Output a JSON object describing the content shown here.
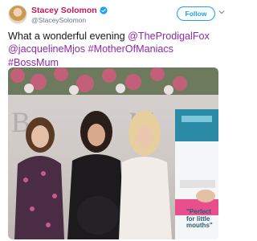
{
  "tweet": {
    "author": {
      "display_name": "Stacey Solomon",
      "handle": "@StaceySolomon",
      "verified": true,
      "name_color": "#c2185b"
    },
    "follow_label": "Follow",
    "text_plain": "What a wonderful evening ",
    "mentions": [
      "@TheProdigalFox",
      "@jacquelineMjos"
    ],
    "hashtags": [
      "#MotherOfManiacs",
      "#BossMum"
    ],
    "link_color": "#8e2aa8"
  },
  "photo": {
    "poster_text": "\"Perfect for little mouths\""
  },
  "icons": {
    "verified": "verified-badge-icon",
    "menu": "chevron-down-icon"
  }
}
